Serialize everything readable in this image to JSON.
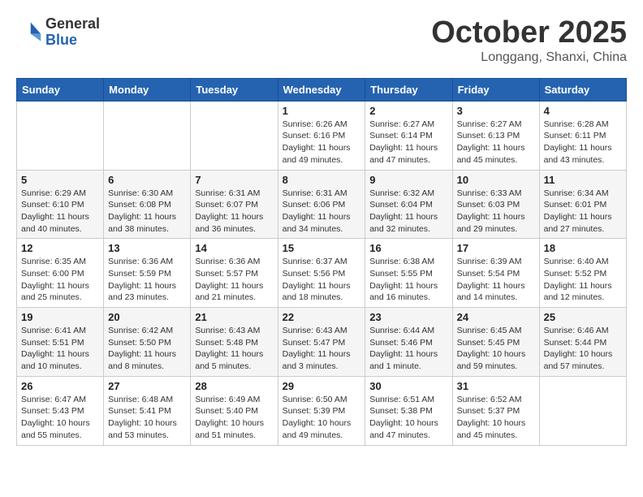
{
  "header": {
    "logo_general": "General",
    "logo_blue": "Blue",
    "month": "October 2025",
    "location": "Longgang, Shanxi, China"
  },
  "weekdays": [
    "Sunday",
    "Monday",
    "Tuesday",
    "Wednesday",
    "Thursday",
    "Friday",
    "Saturday"
  ],
  "weeks": [
    [
      {
        "day": "",
        "info": ""
      },
      {
        "day": "",
        "info": ""
      },
      {
        "day": "",
        "info": ""
      },
      {
        "day": "1",
        "info": "Sunrise: 6:26 AM\nSunset: 6:16 PM\nDaylight: 11 hours\nand 49 minutes."
      },
      {
        "day": "2",
        "info": "Sunrise: 6:27 AM\nSunset: 6:14 PM\nDaylight: 11 hours\nand 47 minutes."
      },
      {
        "day": "3",
        "info": "Sunrise: 6:27 AM\nSunset: 6:13 PM\nDaylight: 11 hours\nand 45 minutes."
      },
      {
        "day": "4",
        "info": "Sunrise: 6:28 AM\nSunset: 6:11 PM\nDaylight: 11 hours\nand 43 minutes."
      }
    ],
    [
      {
        "day": "5",
        "info": "Sunrise: 6:29 AM\nSunset: 6:10 PM\nDaylight: 11 hours\nand 40 minutes."
      },
      {
        "day": "6",
        "info": "Sunrise: 6:30 AM\nSunset: 6:08 PM\nDaylight: 11 hours\nand 38 minutes."
      },
      {
        "day": "7",
        "info": "Sunrise: 6:31 AM\nSunset: 6:07 PM\nDaylight: 11 hours\nand 36 minutes."
      },
      {
        "day": "8",
        "info": "Sunrise: 6:31 AM\nSunset: 6:06 PM\nDaylight: 11 hours\nand 34 minutes."
      },
      {
        "day": "9",
        "info": "Sunrise: 6:32 AM\nSunset: 6:04 PM\nDaylight: 11 hours\nand 32 minutes."
      },
      {
        "day": "10",
        "info": "Sunrise: 6:33 AM\nSunset: 6:03 PM\nDaylight: 11 hours\nand 29 minutes."
      },
      {
        "day": "11",
        "info": "Sunrise: 6:34 AM\nSunset: 6:01 PM\nDaylight: 11 hours\nand 27 minutes."
      }
    ],
    [
      {
        "day": "12",
        "info": "Sunrise: 6:35 AM\nSunset: 6:00 PM\nDaylight: 11 hours\nand 25 minutes."
      },
      {
        "day": "13",
        "info": "Sunrise: 6:36 AM\nSunset: 5:59 PM\nDaylight: 11 hours\nand 23 minutes."
      },
      {
        "day": "14",
        "info": "Sunrise: 6:36 AM\nSunset: 5:57 PM\nDaylight: 11 hours\nand 21 minutes."
      },
      {
        "day": "15",
        "info": "Sunrise: 6:37 AM\nSunset: 5:56 PM\nDaylight: 11 hours\nand 18 minutes."
      },
      {
        "day": "16",
        "info": "Sunrise: 6:38 AM\nSunset: 5:55 PM\nDaylight: 11 hours\nand 16 minutes."
      },
      {
        "day": "17",
        "info": "Sunrise: 6:39 AM\nSunset: 5:54 PM\nDaylight: 11 hours\nand 14 minutes."
      },
      {
        "day": "18",
        "info": "Sunrise: 6:40 AM\nSunset: 5:52 PM\nDaylight: 11 hours\nand 12 minutes."
      }
    ],
    [
      {
        "day": "19",
        "info": "Sunrise: 6:41 AM\nSunset: 5:51 PM\nDaylight: 11 hours\nand 10 minutes."
      },
      {
        "day": "20",
        "info": "Sunrise: 6:42 AM\nSunset: 5:50 PM\nDaylight: 11 hours\nand 8 minutes."
      },
      {
        "day": "21",
        "info": "Sunrise: 6:43 AM\nSunset: 5:48 PM\nDaylight: 11 hours\nand 5 minutes."
      },
      {
        "day": "22",
        "info": "Sunrise: 6:43 AM\nSunset: 5:47 PM\nDaylight: 11 hours\nand 3 minutes."
      },
      {
        "day": "23",
        "info": "Sunrise: 6:44 AM\nSunset: 5:46 PM\nDaylight: 11 hours\nand 1 minute."
      },
      {
        "day": "24",
        "info": "Sunrise: 6:45 AM\nSunset: 5:45 PM\nDaylight: 10 hours\nand 59 minutes."
      },
      {
        "day": "25",
        "info": "Sunrise: 6:46 AM\nSunset: 5:44 PM\nDaylight: 10 hours\nand 57 minutes."
      }
    ],
    [
      {
        "day": "26",
        "info": "Sunrise: 6:47 AM\nSunset: 5:43 PM\nDaylight: 10 hours\nand 55 minutes."
      },
      {
        "day": "27",
        "info": "Sunrise: 6:48 AM\nSunset: 5:41 PM\nDaylight: 10 hours\nand 53 minutes."
      },
      {
        "day": "28",
        "info": "Sunrise: 6:49 AM\nSunset: 5:40 PM\nDaylight: 10 hours\nand 51 minutes."
      },
      {
        "day": "29",
        "info": "Sunrise: 6:50 AM\nSunset: 5:39 PM\nDaylight: 10 hours\nand 49 minutes."
      },
      {
        "day": "30",
        "info": "Sunrise: 6:51 AM\nSunset: 5:38 PM\nDaylight: 10 hours\nand 47 minutes."
      },
      {
        "day": "31",
        "info": "Sunrise: 6:52 AM\nSunset: 5:37 PM\nDaylight: 10 hours\nand 45 minutes."
      },
      {
        "day": "",
        "info": ""
      }
    ]
  ]
}
